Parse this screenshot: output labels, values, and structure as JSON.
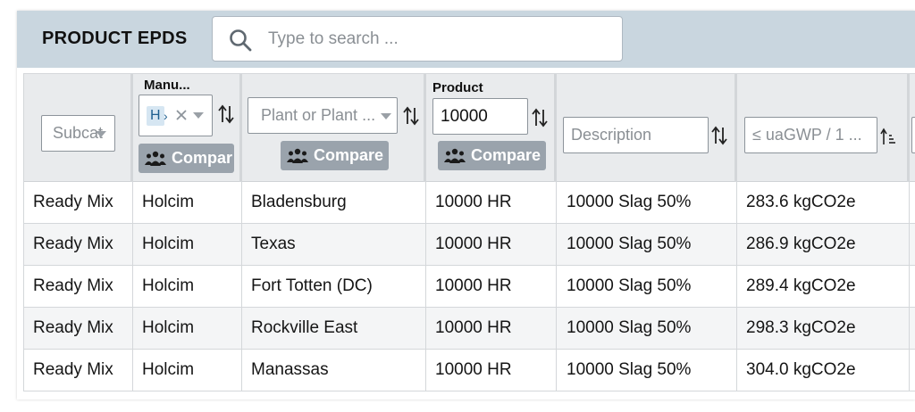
{
  "header": {
    "title": "PRODUCT EPDS",
    "search_placeholder": "Type to search ..."
  },
  "filters": {
    "subcategory": {
      "placeholder": "Subcat..."
    },
    "manufacturer": {
      "label": "Manu...",
      "chip": "H",
      "compare_label": "Compar"
    },
    "plant": {
      "placeholder": "Plant or Plant ...",
      "compare_label": "Compare"
    },
    "product": {
      "label": "Product",
      "value": "10000",
      "compare_label": "Compare"
    },
    "description": {
      "placeholder": "Description"
    },
    "gwp": {
      "placeholder": "≤ uaGWP / 1 ..."
    }
  },
  "table": {
    "rows": [
      {
        "subcategory": "Ready Mix",
        "manufacturer": "Holcim",
        "plant": "Bladensburg",
        "product": "10000 HR",
        "description": "10000 Slag 50%",
        "gwp": "283.6 kgCO2e"
      },
      {
        "subcategory": "Ready Mix",
        "manufacturer": "Holcim",
        "plant": "Texas",
        "product": "10000 HR",
        "description": "10000 Slag 50%",
        "gwp": "286.9 kgCO2e"
      },
      {
        "subcategory": "Ready Mix",
        "manufacturer": "Holcim",
        "plant": "Fort Totten (DC)",
        "product": "10000 HR",
        "description": "10000 Slag 50%",
        "gwp": "289.4 kgCO2e"
      },
      {
        "subcategory": "Ready Mix",
        "manufacturer": "Holcim",
        "plant": "Rockville East",
        "product": "10000 HR",
        "description": "10000 Slag 50%",
        "gwp": "298.3 kgCO2e"
      },
      {
        "subcategory": "Ready Mix",
        "manufacturer": "Holcim",
        "plant": "Manassas",
        "product": "10000 HR",
        "description": "10000 Slag 50%",
        "gwp": "304.0 kgCO2e"
      }
    ]
  },
  "icons": {
    "search": "search-icon",
    "sort": "sort-icon",
    "sort_filtered": "sort-ascending-icon",
    "dropdown": "chevron-down-icon",
    "clear": "close-icon",
    "compare": "people-icon"
  },
  "colors": {
    "header_bg": "#c9d6df",
    "compare_button": "#9aa3ac",
    "filter_bg": "#e9ebed"
  }
}
